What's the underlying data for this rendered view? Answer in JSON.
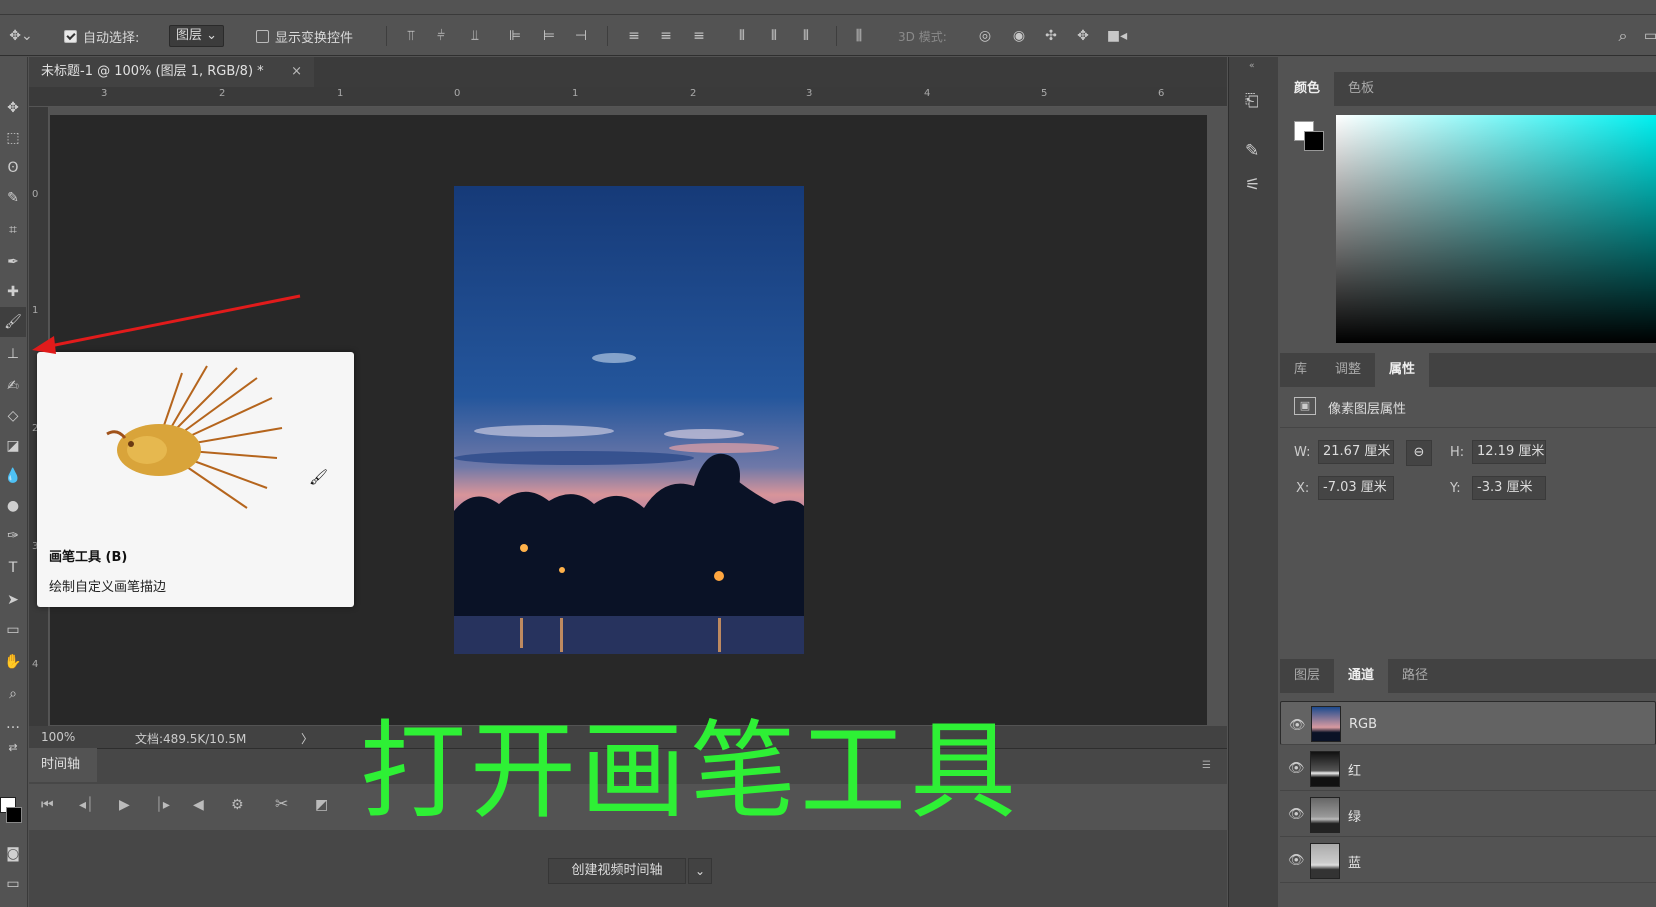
{
  "options_bar": {
    "auto_select_label": "自动选择:",
    "auto_select_target": "图层",
    "show_transform_label": "显示变换控件",
    "mode_3d_label": "3D 模式:"
  },
  "document": {
    "tab_title": "未标题-1 @ 100% (图层 1, RGB/8) *",
    "close_glyph": "×",
    "ruler_h_ticks": [
      "3",
      "2",
      "1",
      "0",
      "1",
      "2",
      "3",
      "4",
      "5",
      "6"
    ],
    "ruler_v_ticks": [
      "0",
      "1",
      "2",
      "3",
      "4"
    ]
  },
  "status": {
    "zoom": "100%",
    "doc_info": "文档:489.5K/10.5M",
    "arrow": "〉"
  },
  "timeline": {
    "tab_label": "时间轴",
    "create_button": "创建视频时间轴"
  },
  "tooltip": {
    "title": "画笔工具 (B)",
    "description": "绘制自定义画笔描边"
  },
  "caption": "打开画笔工具",
  "color_panel": {
    "tabs": [
      "颜色",
      "色板"
    ],
    "active_tab": "颜色"
  },
  "properties_panel": {
    "tabs": [
      "库",
      "调整",
      "属性"
    ],
    "active_tab": "属性",
    "header": "像素图层属性",
    "w_label": "W:",
    "w_value": "21.67 厘米",
    "h_label": "H:",
    "h_value": "12.19 厘米",
    "x_label": "X:",
    "x_value": "-7.03 厘米",
    "y_label": "Y:",
    "y_value": "-3.3 厘米"
  },
  "channels_panel": {
    "tabs": [
      "图层",
      "通道",
      "路径"
    ],
    "active_tab": "通道",
    "rows": [
      {
        "name": "RGB",
        "selected": true
      },
      {
        "name": "红",
        "selected": false
      },
      {
        "name": "绿",
        "selected": false
      },
      {
        "name": "蓝",
        "selected": false
      }
    ]
  },
  "colors": {
    "caption_green": "#2ef035",
    "arrow_red": "#e11b1b",
    "panel_bg": "#535353",
    "canvas_bg": "#282828"
  }
}
